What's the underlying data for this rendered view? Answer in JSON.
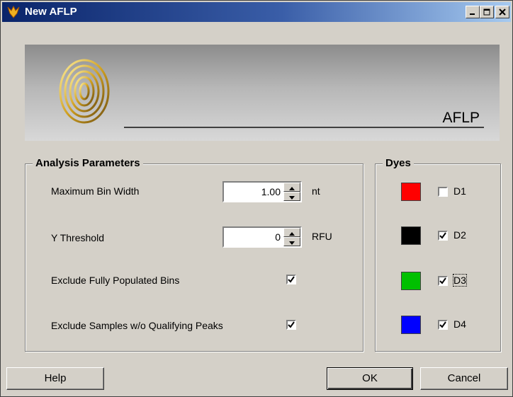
{
  "window": {
    "title": "New AFLP"
  },
  "banner": {
    "title": "AFLP"
  },
  "analysis": {
    "label": "Analysis Parameters",
    "max_bin_width": {
      "label": "Maximum Bin Width",
      "value": "1.00",
      "unit": "nt"
    },
    "y_threshold": {
      "label": "Y Threshold",
      "value": "0",
      "unit": "RFU"
    },
    "exclude_full": {
      "label": "Exclude Fully Populated Bins",
      "checked": true
    },
    "exclude_samples": {
      "label": "Exclude Samples w/o Qualifying Peaks",
      "checked": true
    }
  },
  "dyes": {
    "label": "Dyes",
    "items": [
      {
        "label": "D1",
        "color": "#ff0000",
        "checked": false
      },
      {
        "label": "D2",
        "color": "#000000",
        "checked": true
      },
      {
        "label": "D3",
        "color": "#00c000",
        "checked": true
      },
      {
        "label": "D4",
        "color": "#0000ff",
        "checked": true
      }
    ]
  },
  "buttons": {
    "help": "Help",
    "ok": "OK",
    "cancel": "Cancel"
  }
}
